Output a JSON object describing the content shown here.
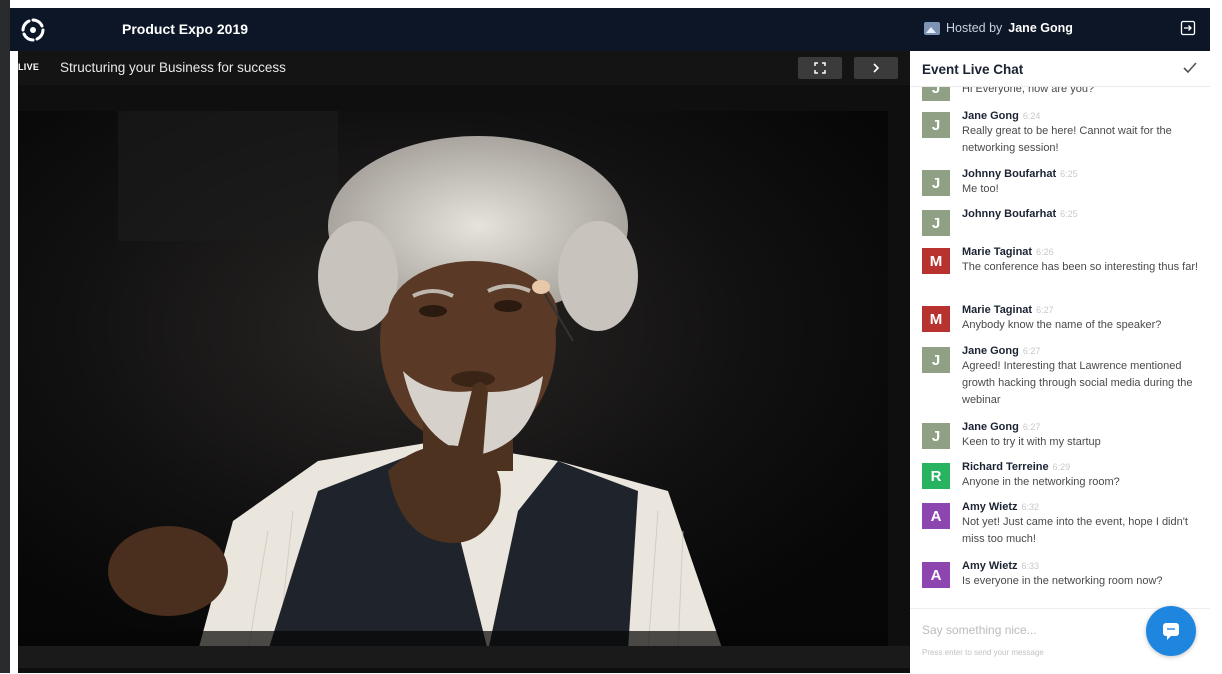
{
  "header": {
    "event_title": "Product Expo 2019",
    "hosted_by_prefix": "Hosted by",
    "host_name": "Jane Gong"
  },
  "stage": {
    "live_label": "LIVE",
    "session_title": "Structuring your Business for success"
  },
  "chat": {
    "title": "Event Live Chat",
    "messages": [
      {
        "author": "",
        "time": "",
        "initial": "J",
        "color": "#8fa085",
        "text": "Hi Everyone, how are you?"
      },
      {
        "author": "Jane Gong",
        "time": "6:24",
        "initial": "J",
        "color": "#8fa085",
        "text": "Really great to be here! Cannot wait for the networking session!"
      },
      {
        "author": "Johnny Boufarhat",
        "time": "6:25",
        "initial": "J",
        "color": "#8fa085",
        "text": "Me too!"
      },
      {
        "author": "Johnny Boufarhat",
        "time": "6:25",
        "initial": "J",
        "color": "#8fa085",
        "text": ""
      },
      {
        "author": "Marie Taginat",
        "time": "6:26",
        "initial": "M",
        "color": "#b83330",
        "text": "The conference has been so interesting thus far!"
      },
      {
        "author": "Marie Taginat",
        "time": "6:27",
        "initial": "M",
        "color": "#b83330",
        "text": "Anybody know the name of the speaker?"
      },
      {
        "author": "Jane Gong",
        "time": "6:27",
        "initial": "J",
        "color": "#8fa085",
        "text": "Agreed! Interesting that Lawrence mentioned growth hacking through social media during the webinar"
      },
      {
        "author": "Jane Gong",
        "time": "6:27",
        "initial": "J",
        "color": "#8fa085",
        "text": "Keen to try it with my startup"
      },
      {
        "author": "Richard Terreine",
        "time": "6:29",
        "initial": "R",
        "color": "#27b35f",
        "text": "Anyone in the networking room?"
      },
      {
        "author": "Amy Wietz",
        "time": "6:32",
        "initial": "A",
        "color": "#8d45b0",
        "text": "Not yet! Just came into the event, hope I didn't miss too much!"
      },
      {
        "author": "Amy Wietz",
        "time": "6:33",
        "initial": "A",
        "color": "#8d45b0",
        "text": "Is everyone in the networking room now?"
      }
    ],
    "input_placeholder": "Say something nice...",
    "input_hint": "Press enter to send your message"
  },
  "icons": {
    "logo": "aperture-logo-icon",
    "host": "image-icon",
    "exit": "exit-icon",
    "fullscreen": "fullscreen-icon",
    "next": "chevron-right-icon",
    "check": "checkmark-icon",
    "chat_fab": "chat-bubble-icon"
  },
  "colors": {
    "topbar": "#0c1627",
    "chat_fab": "#1f86e0"
  }
}
